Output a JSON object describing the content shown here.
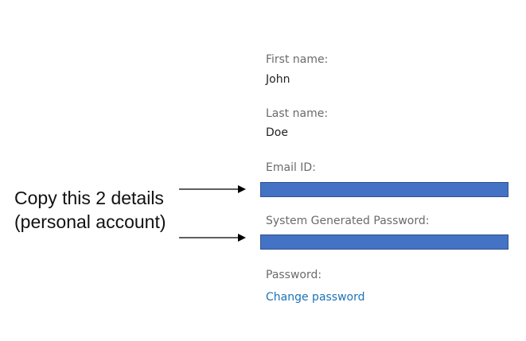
{
  "profile": {
    "first_name_label": "First name:",
    "first_name_value": "John",
    "last_name_label": "Last name:",
    "last_name_value": "Doe",
    "email_label": "Email ID:",
    "system_password_label": "System Generated Password:",
    "password_label": "Password:",
    "change_password_link": "Change password"
  },
  "annotation": {
    "note_text": "Copy this 2 details (personal account)"
  },
  "colors": {
    "redaction_fill": "#4472c4",
    "link": "#1a73b8",
    "label": "#6b6b6b"
  }
}
